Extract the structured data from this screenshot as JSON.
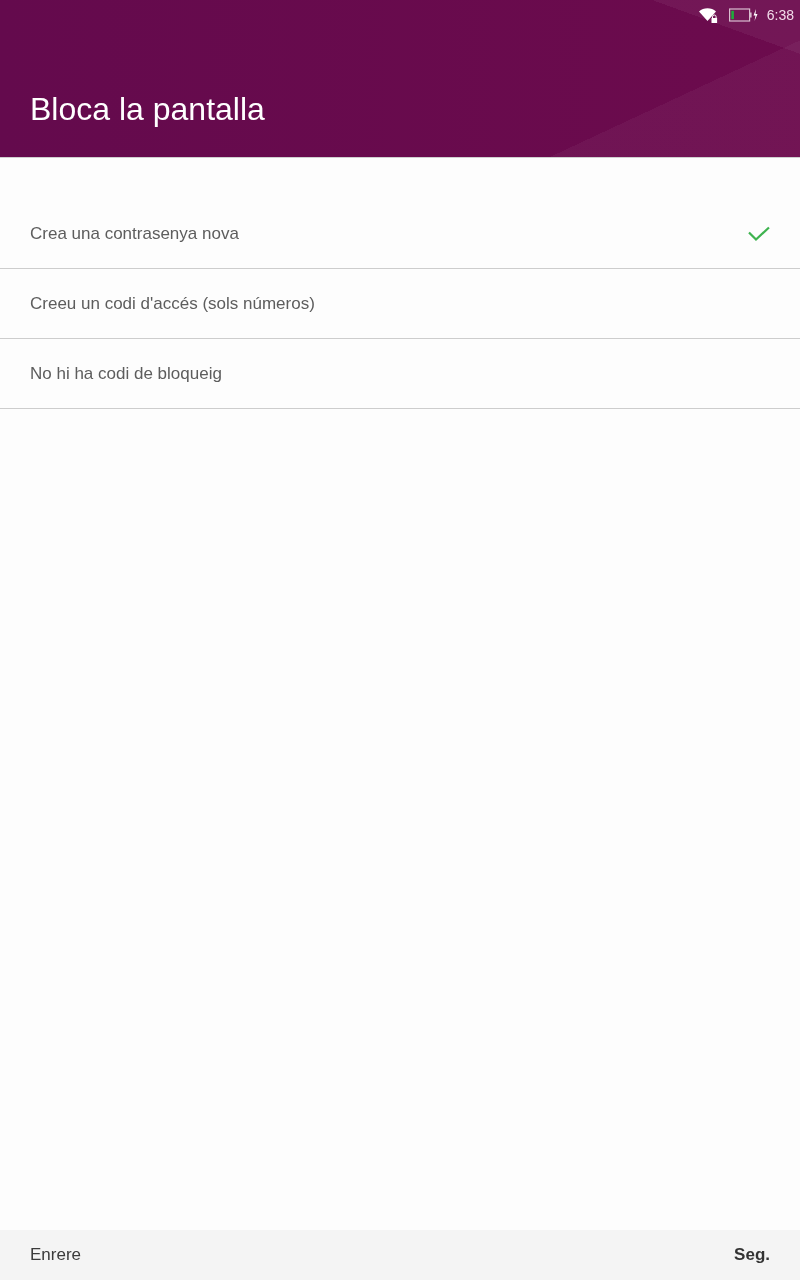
{
  "status_bar": {
    "time": "6:38"
  },
  "header": {
    "title": "Bloca la pantalla"
  },
  "options": [
    {
      "label": "Crea una contrasenya nova",
      "selected": true
    },
    {
      "label": "Creeu un codi d'accés (sols números)",
      "selected": false
    },
    {
      "label": "No hi ha codi de bloqueig",
      "selected": false
    }
  ],
  "footer": {
    "back": "Enrere",
    "next": "Seg."
  }
}
